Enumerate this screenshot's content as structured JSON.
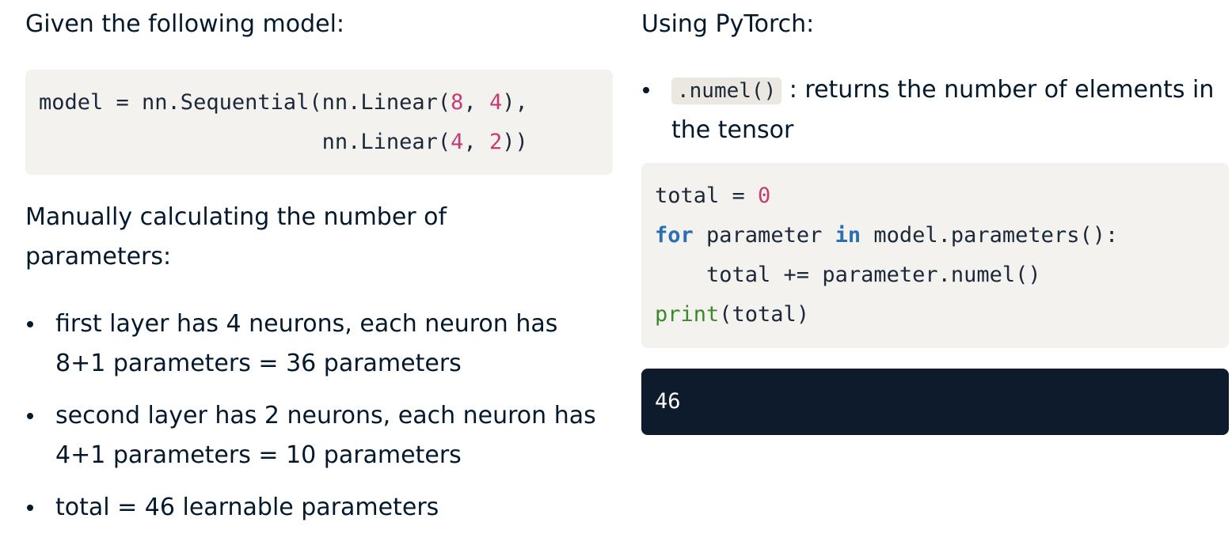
{
  "left": {
    "heading": "Given the following model:",
    "model_code": {
      "line1_pre": "model = nn.Sequential(nn.Linear(",
      "line1_n1": "8",
      "line1_mid": ", ",
      "line1_n2": "4",
      "line1_post": "),",
      "line2_pre": "                      nn.Linear(",
      "line2_n1": "4",
      "line2_mid": ", ",
      "line2_n2": "2",
      "line2_post": "))"
    },
    "paragraph": "Manually calculating the number of parameters:",
    "bullets": [
      "first layer has 4 neurons, each neuron has 8+1 parameters = 36 parameters",
      "second layer has 2 neurons, each neuron has 4+1 parameters = 10 parameters",
      "total = 46 learnable parameters"
    ]
  },
  "right": {
    "heading": "Using PyTorch:",
    "bullet_code": ".numel()",
    "bullet_text": " : returns the number of elements in the tensor",
    "loop_code": {
      "l1_pre": "total = ",
      "l1_num": "0",
      "l2_kw1": "for",
      "l2_mid": " parameter ",
      "l2_kw2": "in",
      "l2_post": " model.parameters():",
      "l3": "    total += parameter.numel()",
      "l4_fn": "print",
      "l4_post": "(total)"
    },
    "output": "46"
  }
}
